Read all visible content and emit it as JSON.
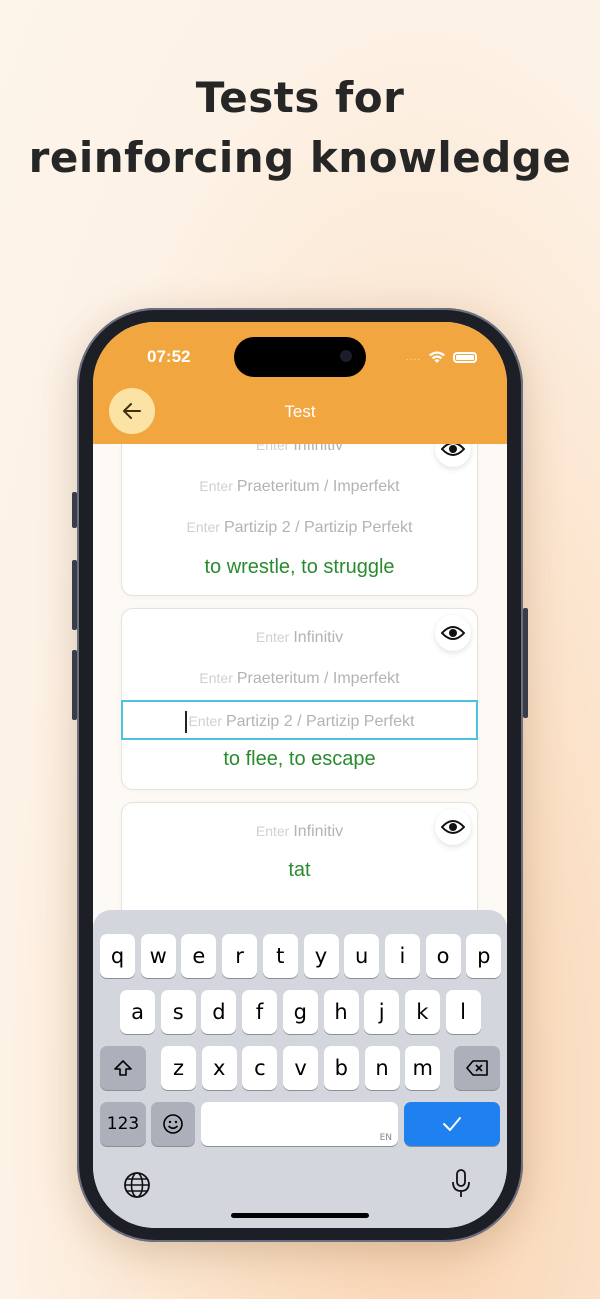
{
  "headline": {
    "line1": "Tests for",
    "line2": "reinforcing knowledge"
  },
  "status_bar": {
    "time": "07:52",
    "dots": "...."
  },
  "nav": {
    "title": "Test",
    "back_icon": "arrow-left-icon"
  },
  "cards": [
    {
      "fields": [
        {
          "prefix": "Enter",
          "label": "Infinitiv"
        },
        {
          "prefix": "Enter",
          "label": "Praeteritum / Imperfekt"
        },
        {
          "prefix": "Enter",
          "label": "Partizip 2 / Partizip Perfekt"
        }
      ],
      "translation": "to wrestle, to struggle"
    },
    {
      "fields": [
        {
          "prefix": "Enter",
          "label": "Infinitiv"
        },
        {
          "prefix": "Enter",
          "label": "Praeteritum / Imperfekt"
        },
        {
          "prefix": "Enter",
          "label": "Partizip 2 / Partizip Perfekt"
        }
      ],
      "translation": "to flee, to escape",
      "focused_field": "Partizip 2 / Partizip Perfekt"
    },
    {
      "fields": [
        {
          "prefix": "Enter",
          "label": "Infinitiv"
        }
      ],
      "filled_value": "tat"
    }
  ],
  "keyboard": {
    "row1": [
      "q",
      "w",
      "e",
      "r",
      "t",
      "y",
      "u",
      "i",
      "o",
      "p"
    ],
    "row2": [
      "a",
      "s",
      "d",
      "f",
      "g",
      "h",
      "j",
      "k",
      "l"
    ],
    "row3": [
      "z",
      "x",
      "c",
      "v",
      "b",
      "n",
      "m"
    ],
    "numbers_key": "123",
    "space_lang": "EN",
    "shift_icon": "shift-icon",
    "delete_icon": "backspace-icon",
    "emoji_icon": "emoji-icon",
    "done_icon": "checkmark-icon",
    "globe_icon": "globe-icon",
    "mic_icon": "microphone-icon"
  },
  "colors": {
    "accent": "#f2a63f",
    "translation": "#2a8a2f",
    "focus": "#4cc3e0",
    "done": "#1f80f0"
  }
}
